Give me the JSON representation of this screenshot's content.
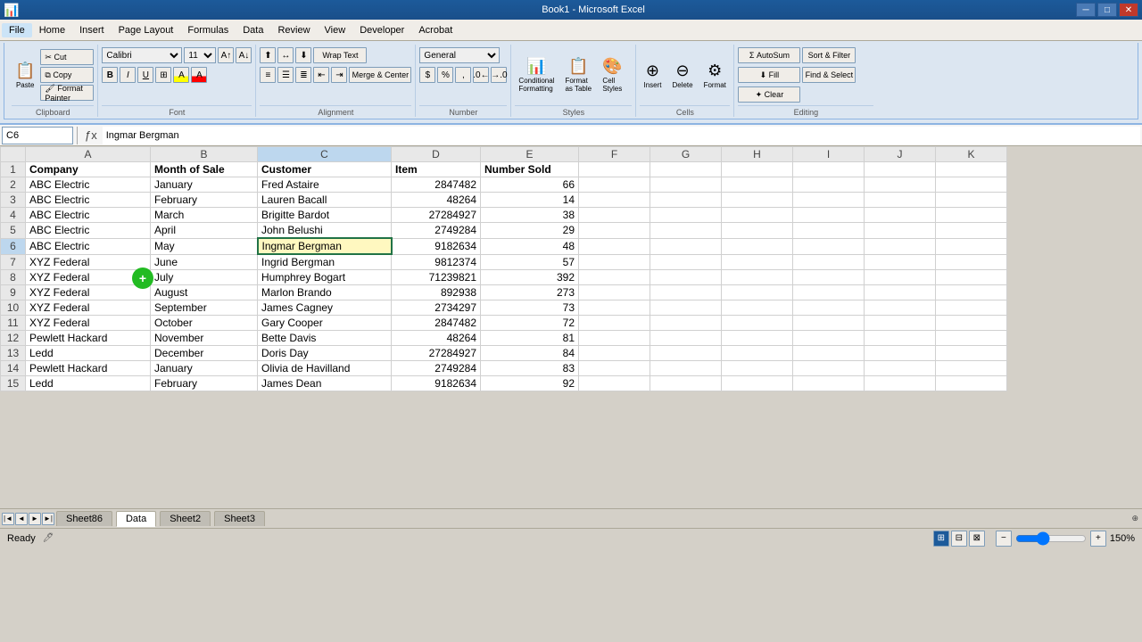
{
  "titleBar": {
    "title": "Book1 - Microsoft Excel",
    "minimizeBtn": "─",
    "maximizeBtn": "□",
    "closeBtn": "✕"
  },
  "menuBar": {
    "items": [
      "File",
      "Home",
      "Insert",
      "Page Layout",
      "Formulas",
      "Data",
      "Review",
      "View",
      "Developer",
      "Acrobat"
    ]
  },
  "ribbon": {
    "activeTab": "Home",
    "groups": [
      {
        "label": "Clipboard",
        "buttons": [
          "Paste",
          "Cut",
          "Copy",
          "Format Painter"
        ]
      },
      {
        "label": "Font",
        "fontName": "Calibri",
        "fontSize": "11"
      },
      {
        "label": "Alignment"
      },
      {
        "label": "Number",
        "format": "General"
      },
      {
        "label": "Styles"
      },
      {
        "label": "Cells",
        "buttons": [
          "Insert",
          "Delete",
          "Format"
        ]
      },
      {
        "label": "Editing",
        "buttons": [
          "AutoSum",
          "Fill",
          "Clear",
          "Sort & Filter",
          "Find & Select"
        ]
      }
    ]
  },
  "formulaBar": {
    "nameBox": "C6",
    "formula": "Ingmar Bergman"
  },
  "columns": {
    "headers": [
      "",
      "A",
      "B",
      "C",
      "D",
      "E",
      "F",
      "G",
      "H",
      "I",
      "J",
      "K"
    ],
    "widths": [
      28,
      140,
      120,
      150,
      100,
      110,
      80,
      80,
      80,
      80,
      80,
      80
    ]
  },
  "headers": {
    "row1": [
      "Company",
      "Month of Sale",
      "Customer",
      "Item",
      "Number Sold"
    ]
  },
  "rows": [
    {
      "num": "1",
      "a": "Company",
      "b": "Month of Sale",
      "c": "Customer",
      "d": "Item",
      "e": "Number Sold",
      "f": "",
      "g": "",
      "h": "",
      "i": "",
      "j": "",
      "k": ""
    },
    {
      "num": "2",
      "a": "ABC Electric",
      "b": "January",
      "c": "Fred Astaire",
      "d": "2847482",
      "e": "66",
      "f": "",
      "g": "",
      "h": "",
      "i": "",
      "j": "",
      "k": ""
    },
    {
      "num": "3",
      "a": "ABC Electric",
      "b": "February",
      "c": "Lauren Bacall",
      "d": "48264",
      "e": "14",
      "f": "",
      "g": "",
      "h": "",
      "i": "",
      "j": "",
      "k": ""
    },
    {
      "num": "4",
      "a": "ABC Electric",
      "b": "March",
      "c": "Brigitte Bardot",
      "d": "27284927",
      "e": "38",
      "f": "",
      "g": "",
      "h": "",
      "i": "",
      "j": "",
      "k": ""
    },
    {
      "num": "5",
      "a": "ABC Electric",
      "b": "April",
      "c": "John Belushi",
      "d": "2749284",
      "e": "29",
      "f": "",
      "g": "",
      "h": "",
      "i": "",
      "j": "",
      "k": ""
    },
    {
      "num": "6",
      "a": "ABC Electric",
      "b": "May",
      "c": "Ingmar Bergman",
      "d": "9182634",
      "e": "48",
      "f": "",
      "g": "",
      "h": "",
      "i": "",
      "j": "",
      "k": ""
    },
    {
      "num": "7",
      "a": "XYZ Federal",
      "b": "June",
      "c": "Ingrid Bergman",
      "d": "9812374",
      "e": "57",
      "f": "",
      "g": "",
      "h": "",
      "i": "",
      "j": "",
      "k": ""
    },
    {
      "num": "8",
      "a": "XYZ Federal",
      "b": "July",
      "c": "Humphrey Bogart",
      "d": "71239821",
      "e": "392",
      "f": "",
      "g": "",
      "h": "",
      "i": "",
      "j": "",
      "k": ""
    },
    {
      "num": "9",
      "a": "XYZ Federal",
      "b": "August",
      "c": "Marlon Brando",
      "d": "892938",
      "e": "273",
      "f": "",
      "g": "",
      "h": "",
      "i": "",
      "j": "",
      "k": ""
    },
    {
      "num": "10",
      "a": "XYZ Federal",
      "b": "September",
      "c": "James Cagney",
      "d": "2734297",
      "e": "73",
      "f": "",
      "g": "",
      "h": "",
      "i": "",
      "j": "",
      "k": ""
    },
    {
      "num": "11",
      "a": "XYZ Federal",
      "b": "October",
      "c": "Gary Cooper",
      "d": "2847482",
      "e": "72",
      "f": "",
      "g": "",
      "h": "",
      "i": "",
      "j": "",
      "k": ""
    },
    {
      "num": "12",
      "a": "Pewlett Hackard",
      "b": "November",
      "c": "Bette Davis",
      "d": "48264",
      "e": "81",
      "f": "",
      "g": "",
      "h": "",
      "i": "",
      "j": "",
      "k": ""
    },
    {
      "num": "13",
      "a": "Ledd",
      "b": "December",
      "c": "Doris Day",
      "d": "27284927",
      "e": "84",
      "f": "",
      "g": "",
      "h": "",
      "i": "",
      "j": "",
      "k": ""
    },
    {
      "num": "14",
      "a": "Pewlett Hackard",
      "b": "January",
      "c": "Olivia de Havilland",
      "d": "2749284",
      "e": "83",
      "f": "",
      "g": "",
      "h": "",
      "i": "",
      "j": "",
      "k": ""
    },
    {
      "num": "15",
      "a": "Ledd",
      "b": "February",
      "c": "James Dean",
      "d": "9182634",
      "e": "92",
      "f": "",
      "g": "",
      "h": "",
      "i": "",
      "j": "",
      "k": ""
    }
  ],
  "sheetTabs": {
    "tabs": [
      "Sheet86",
      "Data",
      "Sheet2",
      "Sheet3"
    ],
    "activeTab": "Data"
  },
  "statusBar": {
    "status": "Ready",
    "zoom": "150%"
  },
  "selectedCell": {
    "name": "C6",
    "value": "Ingmar Bergman"
  }
}
